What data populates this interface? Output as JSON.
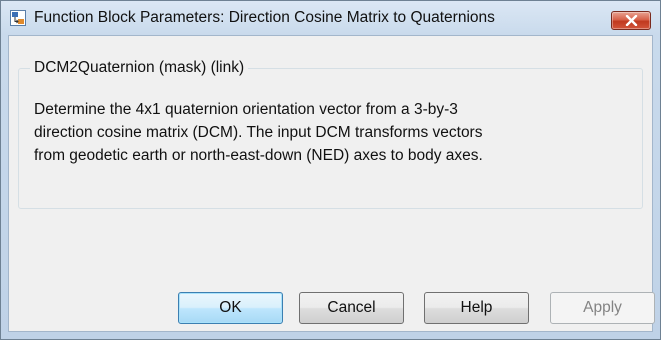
{
  "window": {
    "title": "Function Block Parameters: Direction Cosine Matrix to Quaternions",
    "app_icon": "simulink-block-icon",
    "close_icon": "close-icon"
  },
  "group": {
    "title": "DCM2Quaternion (mask) (link)",
    "description_lines": [
      "Determine the 4x1 quaternion orientation vector from a 3-by-3",
      "direction cosine matrix (DCM). The input DCM transforms vectors",
      "from geodetic earth or north-east-down (NED) axes to body axes."
    ]
  },
  "buttons": {
    "ok": "OK",
    "cancel": "Cancel",
    "help": "Help",
    "apply": "Apply"
  },
  "colors": {
    "close_button": "#c9442a",
    "default_button_border": "#3c7fb1",
    "disabled_text": "#838383"
  }
}
